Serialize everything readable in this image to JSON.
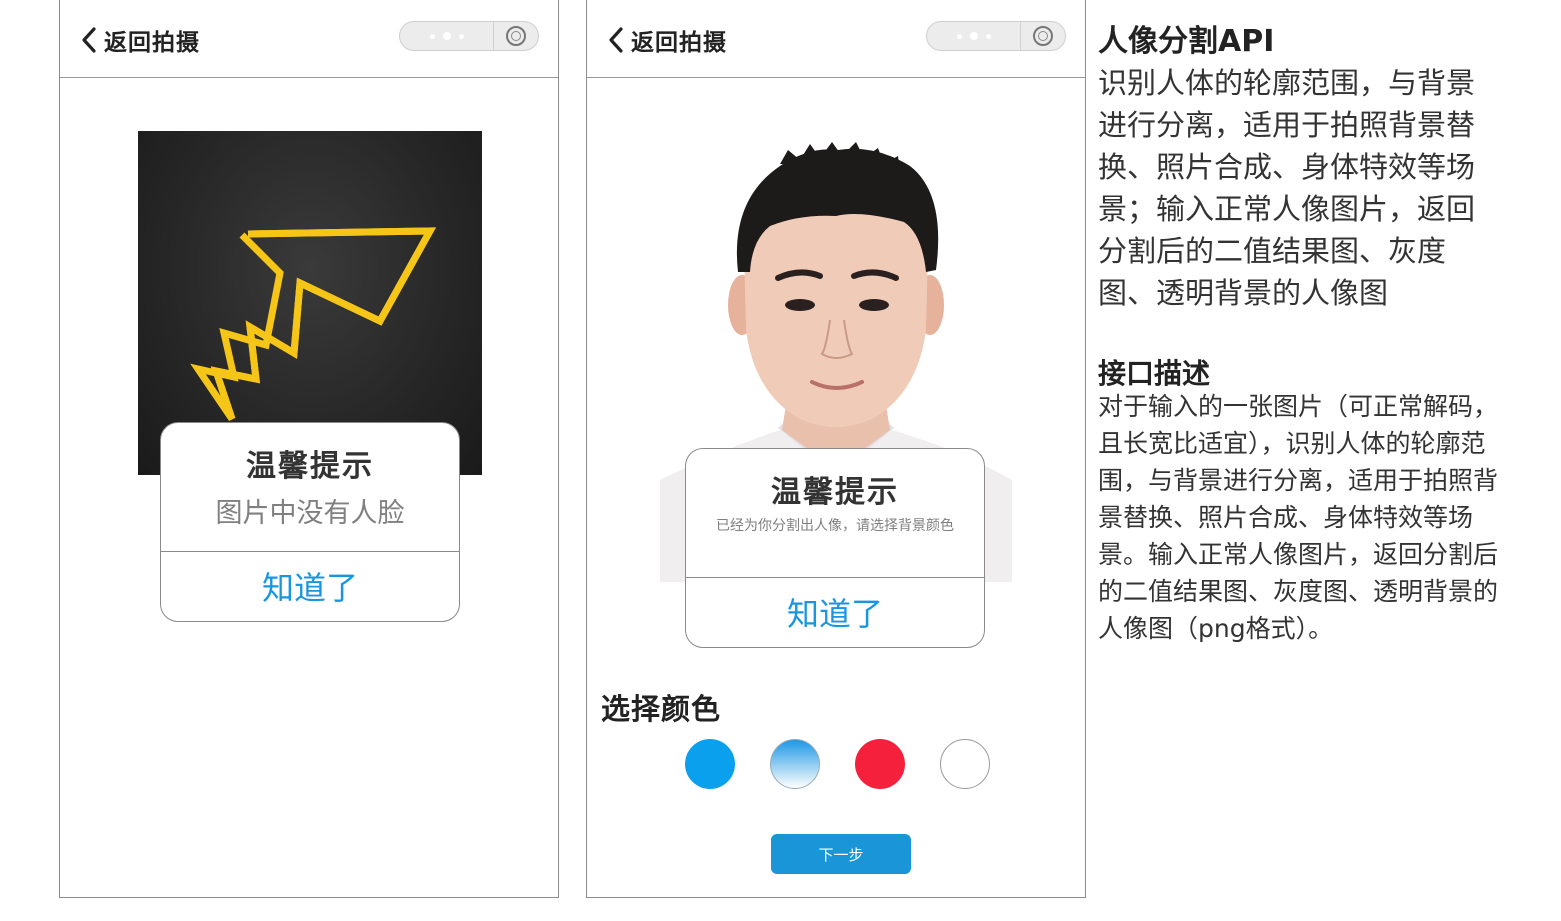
{
  "panels": [
    {
      "nav": {
        "back_label": "返回拍摄"
      },
      "dialog": {
        "title": "温馨提示",
        "message": "图片中没有人脸",
        "button": "知道了"
      }
    },
    {
      "nav": {
        "back_label": "返回拍摄"
      },
      "dialog": {
        "title": "温馨提示",
        "message": "已经为你分割出人像，请选择背景颜色",
        "button": "知道了"
      },
      "color_section": {
        "label": "选择颜色",
        "swatches": [
          {
            "name": "blue",
            "color": "#0aa0ee"
          },
          {
            "name": "gradient-blue",
            "color": "#1d98e5"
          },
          {
            "name": "red",
            "color": "#f5203b"
          },
          {
            "name": "white",
            "color": "#ffffff"
          }
        ]
      },
      "next_button": "下一步"
    }
  ],
  "side": {
    "title": "人像分割API",
    "description": "识别人体的轮廓范围，与背景进行分离，适用于拍照背景替换、照片合成、身体特效等场景；输入正常人像图片，返回分割后的二值结果图、灰度图、透明背景的人像图",
    "subtitle": "接口描述",
    "body": "对于输入的一张图片（可正常解码，且长宽比适宜），识别人体的轮廓范围，与背景进行分离，适用于拍照背景替换、照片合成、身体特效等场景。输入正常人像图片，返回分割后的二值结果图、灰度图、透明背景的人像图（png格式）。"
  },
  "colors": {
    "accent": "#1a96df",
    "button_bg": "#1a96d8",
    "bolt": "#f5c518"
  }
}
